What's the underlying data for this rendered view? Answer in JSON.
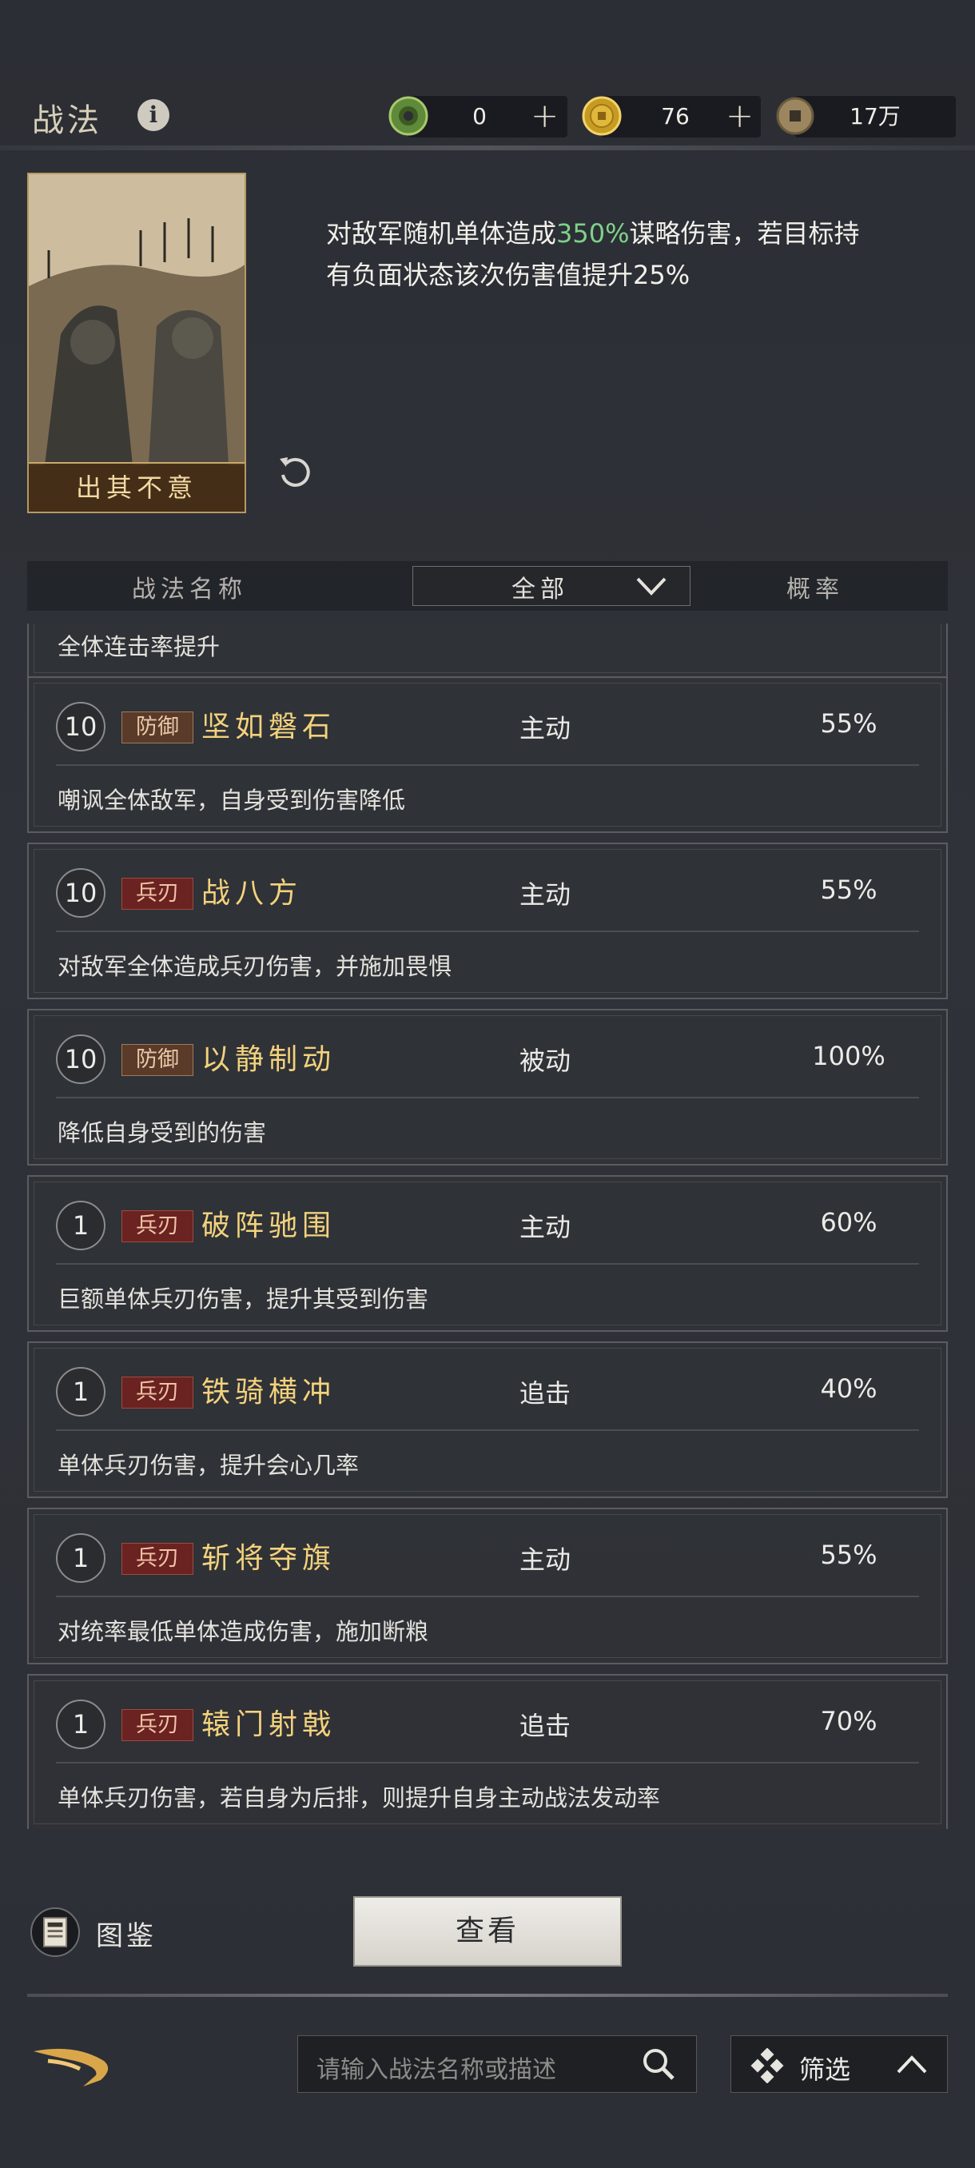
{
  "header": {
    "title": "战法",
    "currencies": [
      {
        "icon": "jade-coin-icon",
        "value": "0"
      },
      {
        "icon": "gold-coin-icon",
        "value": "76"
      },
      {
        "icon": "copper-coin-icon",
        "value": "17万"
      }
    ],
    "plus": "+"
  },
  "detail": {
    "card_name": "出其不意",
    "desc_pre": "对敌军随机单体造成",
    "desc_value": "350%",
    "desc_post": "谋略伤害，若目标持有负面状态该次伤害值提升25%",
    "highlight_color": "#7fd18a"
  },
  "list_header": {
    "name_col": "战法名称",
    "filter_selected": "全部",
    "rate_col": "概率"
  },
  "partial_row_text": "全体连击率提升",
  "skills": [
    {
      "level": "10",
      "tag": "防御",
      "tag_type": "def",
      "name": "坚如磐石",
      "type": "主动",
      "rate": "55%",
      "desc": "嘲讽全体敌军，自身受到伤害降低"
    },
    {
      "level": "10",
      "tag": "兵刃",
      "tag_type": "atk",
      "name": "战八方",
      "type": "主动",
      "rate": "55%",
      "desc": "对敌军全体造成兵刃伤害，并施加畏惧"
    },
    {
      "level": "10",
      "tag": "防御",
      "tag_type": "def",
      "name": "以静制动",
      "type": "被动",
      "rate": "100%",
      "desc": "降低自身受到的伤害"
    },
    {
      "level": "1",
      "tag": "兵刃",
      "tag_type": "atk",
      "name": "破阵驰围",
      "type": "主动",
      "rate": "60%",
      "desc": "巨额单体兵刃伤害，提升其受到伤害"
    },
    {
      "level": "1",
      "tag": "兵刃",
      "tag_type": "atk",
      "name": "铁骑横冲",
      "type": "追击",
      "rate": "40%",
      "desc": "单体兵刃伤害，提升会心几率"
    },
    {
      "level": "1",
      "tag": "兵刃",
      "tag_type": "atk",
      "name": "斩将夺旗",
      "type": "主动",
      "rate": "55%",
      "desc": "对统率最低单体造成伤害，施加断粮"
    },
    {
      "level": "1",
      "tag": "兵刃",
      "tag_type": "atk",
      "name": "辕门射戟",
      "type": "追击",
      "rate": "70%",
      "desc": "单体兵刃伤害，若自身为后排，则提升自身主动战法发动率"
    }
  ],
  "bottom": {
    "atlas_label": "图鉴",
    "view_button": "查看",
    "search_placeholder": "请输入战法名称或描述",
    "filter_label": "筛选"
  }
}
